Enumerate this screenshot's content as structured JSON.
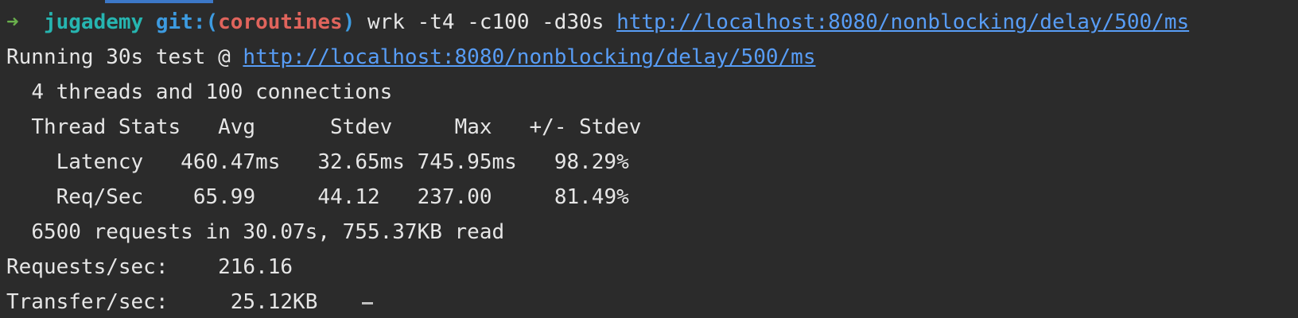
{
  "prompt": {
    "arrow": "➜",
    "directory": "jugademy",
    "git_prefix": "git:(",
    "branch": "coroutines",
    "git_suffix": ")",
    "command": "wrk -t4 -c100 -d30s",
    "url": "http://localhost:8080/nonblocking/delay/500/ms"
  },
  "output": {
    "running_prefix": "Running 30s test @",
    "running_url": "http://localhost:8080/nonblocking/delay/500/ms",
    "threads_line": "4 threads and 100 connections",
    "stats_header": {
      "label": "Thread Stats",
      "avg": "Avg",
      "stdev": "Stdev",
      "max": "Max",
      "pm_stdev": "+/- Stdev"
    },
    "latency": {
      "label": "Latency",
      "avg": "460.47ms",
      "stdev": "32.65ms",
      "max": "745.95ms",
      "pm_stdev": "98.29%"
    },
    "req_sec": {
      "label": "Req/Sec",
      "avg": "65.99",
      "stdev": "44.12",
      "max": "237.00",
      "pm_stdev": "81.49%"
    },
    "summary_line": "6500 requests in 30.07s, 755.37KB read",
    "requests_per_sec": {
      "label": "Requests/sec:",
      "value": "216.16"
    },
    "transfer_per_sec": {
      "label": "Transfer/sec:",
      "value": "25.12KB"
    }
  }
}
